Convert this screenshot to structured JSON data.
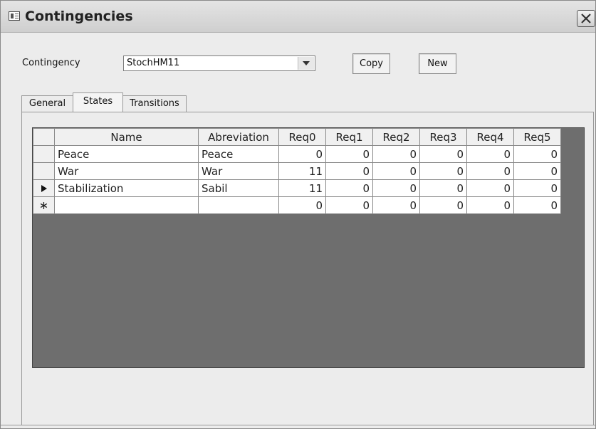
{
  "window": {
    "title": "Contingencies"
  },
  "form": {
    "contingency_label": "Contingency",
    "contingency_value": "StochHM11",
    "copy_label": "Copy",
    "new_label": "New"
  },
  "tabs": [
    {
      "label": "General",
      "active": false
    },
    {
      "label": "States",
      "active": true
    },
    {
      "label": "Transitions",
      "active": false
    }
  ],
  "grid": {
    "columns": [
      "Name",
      "Abreviation",
      "Req0",
      "Req1",
      "Req2",
      "Req3",
      "Req4",
      "Req5"
    ],
    "rows": [
      {
        "selector": "",
        "cells": [
          "Peace",
          "Peace",
          "0",
          "0",
          "0",
          "0",
          "0",
          "0"
        ]
      },
      {
        "selector": "",
        "cells": [
          "War",
          "War",
          "11",
          "0",
          "0",
          "0",
          "0",
          "0"
        ]
      },
      {
        "selector": "current-row-icon",
        "cells": [
          "Stabilization",
          "Sabil",
          "11",
          "0",
          "0",
          "0",
          "0",
          "0"
        ]
      },
      {
        "selector": "new-row-icon",
        "cells": [
          "",
          "",
          "0",
          "0",
          "0",
          "0",
          "0",
          "0"
        ]
      }
    ]
  }
}
